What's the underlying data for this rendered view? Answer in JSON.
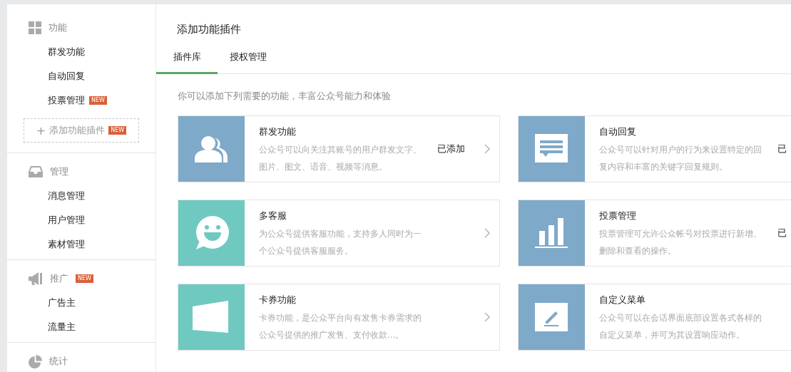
{
  "sidebar": {
    "sections": [
      {
        "kind": "grid",
        "label": "功能",
        "items": [
          {
            "label": "群发功能"
          },
          {
            "label": "自动回复"
          },
          {
            "label": "投票管理",
            "badge": "NEW"
          }
        ],
        "add_button": {
          "icon": "+",
          "label": "添加功能插件",
          "badge": "NEW"
        }
      },
      {
        "kind": "inbox",
        "label": "管理",
        "items": [
          {
            "label": "消息管理"
          },
          {
            "label": "用户管理"
          },
          {
            "label": "素材管理"
          }
        ]
      },
      {
        "kind": "megaphone",
        "label": "推广",
        "badge": "NEW",
        "items": [
          {
            "label": "广告主"
          },
          {
            "label": "流量主"
          }
        ]
      },
      {
        "kind": "pie",
        "label": "统计"
      }
    ]
  },
  "page": {
    "title": "添加功能插件",
    "tabs": [
      {
        "label": "插件库",
        "selected": true
      },
      {
        "label": "授权管理",
        "selected": false
      }
    ],
    "intro": "你可以添加下列需要的功能，丰富公众号能力和体验",
    "cards": [
      {
        "kind": "people",
        "color": "#7fa9c9",
        "title": "群发功能",
        "description": "公众号可以向关注其账号的用户群发文字、图片、图文、语音、视频等消息。",
        "status": "已添加"
      },
      {
        "kind": "message",
        "color": "#7fa9c9",
        "title": "自动回复",
        "description": "公众号可以针对用户的行为来设置特定的回复内容和丰富的关键字回复规则。",
        "status": "已"
      },
      {
        "kind": "smile",
        "color": "#6fc9c0",
        "title": "多客服",
        "description": "为公众号提供客服功能，支持多人同时为一个公众号提供客服服务。"
      },
      {
        "kind": "chart",
        "color": "#7fa9c9",
        "title": "投票管理",
        "description": "投票管理可允许公众帐号对投票进行新增、删除和查看的操作。",
        "status": "已"
      },
      {
        "kind": "card",
        "color": "#6fc9c0",
        "title": "卡券功能",
        "description": "卡券功能，是公众平台向有发售卡券需求的公众号提供的推广发售、支付收款...。"
      },
      {
        "kind": "edit",
        "color": "#7fa9c9",
        "title": "自定义菜单",
        "description": "公众号可以在会话界面底部设置各式各样的自定义菜单，并可为其设置响应动作。"
      }
    ]
  }
}
